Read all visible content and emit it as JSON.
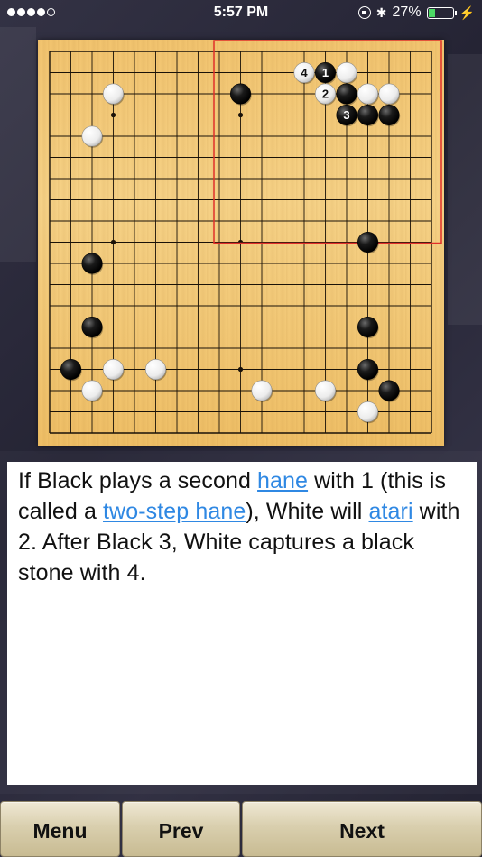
{
  "status_bar": {
    "time": "5:57 PM",
    "battery_percent": "27%",
    "battery_level": 0.27,
    "signal_bars_filled": 4,
    "signal_bars_total": 5
  },
  "board": {
    "size": 19,
    "star_points": [
      [
        3,
        3
      ],
      [
        9,
        3
      ],
      [
        3,
        9
      ],
      [
        9,
        9
      ],
      [
        3,
        15
      ],
      [
        9,
        15
      ]
    ],
    "highlight_region": {
      "from_col": 8,
      "to_col": 18,
      "from_row": 0,
      "to_row": 9,
      "color": "#e0302a"
    },
    "stones": [
      {
        "col": 12,
        "row": 1,
        "color": "white",
        "label": "4"
      },
      {
        "col": 13,
        "row": 1,
        "color": "black",
        "label": "1"
      },
      {
        "col": 14,
        "row": 1,
        "color": "white",
        "label": ""
      },
      {
        "col": 3,
        "row": 2,
        "color": "white",
        "label": ""
      },
      {
        "col": 9,
        "row": 2,
        "color": "black",
        "label": ""
      },
      {
        "col": 13,
        "row": 2,
        "color": "white",
        "label": "2"
      },
      {
        "col": 14,
        "row": 2,
        "color": "black",
        "label": ""
      },
      {
        "col": 15,
        "row": 2,
        "color": "white",
        "label": ""
      },
      {
        "col": 16,
        "row": 2,
        "color": "white",
        "label": ""
      },
      {
        "col": 14,
        "row": 3,
        "color": "black",
        "label": "3"
      },
      {
        "col": 15,
        "row": 3,
        "color": "black",
        "label": ""
      },
      {
        "col": 16,
        "row": 3,
        "color": "black",
        "label": ""
      },
      {
        "col": 2,
        "row": 4,
        "color": "white",
        "label": ""
      },
      {
        "col": 15,
        "row": 9,
        "color": "black",
        "label": ""
      },
      {
        "col": 2,
        "row": 10,
        "color": "black",
        "label": ""
      },
      {
        "col": 2,
        "row": 13,
        "color": "black",
        "label": ""
      },
      {
        "col": 15,
        "row": 13,
        "color": "black",
        "label": ""
      },
      {
        "col": 1,
        "row": 15,
        "color": "black",
        "label": ""
      },
      {
        "col": 3,
        "row": 15,
        "color": "white",
        "label": ""
      },
      {
        "col": 5,
        "row": 15,
        "color": "white",
        "label": ""
      },
      {
        "col": 15,
        "row": 15,
        "color": "black",
        "label": ""
      },
      {
        "col": 2,
        "row": 16,
        "color": "white",
        "label": ""
      },
      {
        "col": 10,
        "row": 16,
        "color": "white",
        "label": ""
      },
      {
        "col": 13,
        "row": 16,
        "color": "white",
        "label": ""
      },
      {
        "col": 16,
        "row": 16,
        "color": "black",
        "label": ""
      },
      {
        "col": 15,
        "row": 17,
        "color": "white",
        "label": ""
      }
    ]
  },
  "explanation": {
    "t1": "If Black plays a second ",
    "link1": "hane",
    "t2": " with 1 (this is called a ",
    "link2": "two-step hane",
    "t3": "), White will ",
    "link3": "atari",
    "t4": " with 2. After Black 3, White captures a black stone with 4."
  },
  "buttons": {
    "menu": "Menu",
    "prev": "Prev",
    "next": "Next"
  },
  "colors": {
    "link": "#2f88e3",
    "highlight": "#e0302a",
    "battery": "#4cd964"
  }
}
